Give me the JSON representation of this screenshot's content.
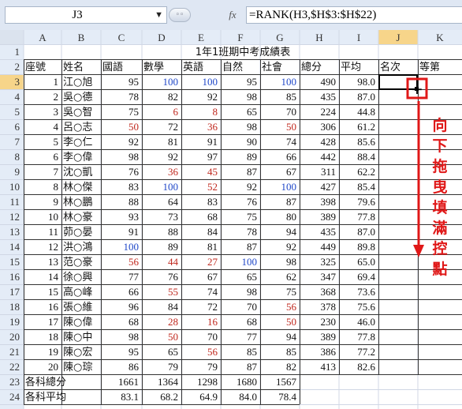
{
  "formula_bar": {
    "name_box": "J3",
    "fx_label": "fx",
    "formula": "=RANK(H3,$H$3:$H$22)"
  },
  "columns": [
    "A",
    "B",
    "C",
    "D",
    "E",
    "F",
    "G",
    "H",
    "I",
    "J",
    "K"
  ],
  "rows": [
    "1",
    "2",
    "3",
    "4",
    "5",
    "6",
    "7",
    "8",
    "9",
    "10",
    "11",
    "12",
    "13",
    "14",
    "15",
    "16",
    "17",
    "18",
    "19",
    "20",
    "21",
    "22",
    "23",
    "24"
  ],
  "title": "1年1班期中考成績表",
  "headers": [
    "座號",
    "姓名",
    "國語",
    "數學",
    "英語",
    "自然",
    "社會",
    "總分",
    "平均",
    "名次",
    "等第"
  ],
  "students": [
    [
      "1",
      "江○旭",
      "95",
      "100",
      "100",
      "95",
      "100",
      "490",
      "98.0"
    ],
    [
      "2",
      "吳○德",
      "78",
      "82",
      "92",
      "98",
      "85",
      "435",
      "87.0"
    ],
    [
      "3",
      "吳○智",
      "75",
      "6",
      "8",
      "65",
      "70",
      "224",
      "44.8"
    ],
    [
      "4",
      "呂○志",
      "50",
      "72",
      "36",
      "98",
      "50",
      "306",
      "61.2"
    ],
    [
      "5",
      "李○仁",
      "92",
      "81",
      "91",
      "90",
      "74",
      "428",
      "85.6"
    ],
    [
      "6",
      "李○偉",
      "98",
      "92",
      "97",
      "89",
      "66",
      "442",
      "88.4"
    ],
    [
      "7",
      "沈○凱",
      "76",
      "36",
      "45",
      "87",
      "67",
      "311",
      "62.2"
    ],
    [
      "8",
      "林○傑",
      "83",
      "100",
      "52",
      "92",
      "100",
      "427",
      "85.4"
    ],
    [
      "9",
      "林○鵬",
      "88",
      "64",
      "83",
      "76",
      "87",
      "398",
      "79.6"
    ],
    [
      "10",
      "林○豪",
      "93",
      "73",
      "68",
      "75",
      "80",
      "389",
      "77.8"
    ],
    [
      "11",
      "茆○晏",
      "91",
      "88",
      "84",
      "78",
      "94",
      "435",
      "87.0"
    ],
    [
      "12",
      "洪○鴻",
      "100",
      "89",
      "81",
      "87",
      "92",
      "449",
      "89.8"
    ],
    [
      "13",
      "范○豪",
      "56",
      "44",
      "27",
      "100",
      "98",
      "325",
      "65.0"
    ],
    [
      "14",
      "徐○興",
      "77",
      "76",
      "67",
      "65",
      "62",
      "347",
      "69.4"
    ],
    [
      "15",
      "高○峰",
      "66",
      "55",
      "74",
      "98",
      "75",
      "368",
      "73.6"
    ],
    [
      "16",
      "張○維",
      "96",
      "84",
      "72",
      "70",
      "56",
      "378",
      "75.6"
    ],
    [
      "17",
      "陳○偉",
      "68",
      "28",
      "16",
      "68",
      "50",
      "230",
      "46.0"
    ],
    [
      "18",
      "陳○中",
      "98",
      "50",
      "70",
      "77",
      "94",
      "389",
      "77.8"
    ],
    [
      "19",
      "陳○宏",
      "95",
      "65",
      "56",
      "85",
      "85",
      "386",
      "77.2"
    ],
    [
      "20",
      "陳○琮",
      "86",
      "79",
      "79",
      "87",
      "82",
      "413",
      "82.6"
    ]
  ],
  "totals": {
    "label": "各科總分",
    "values": [
      "1661",
      "1364",
      "1298",
      "1680",
      "1567"
    ]
  },
  "averages": {
    "label": "各科平均",
    "values": [
      "83.1",
      "68.2",
      "64.9",
      "84.0",
      "78.4"
    ]
  },
  "annotation": {
    "text": "向下拖曳填滿控點",
    "color": "#e01818"
  },
  "colors": {
    "red_score": "#c0281e",
    "blue_score": "#1f47c8",
    "black": "#111111",
    "header_bg": "#e4ecf7",
    "selected_header_bg": "#f7d58a",
    "grid_line": "#d0d7e5"
  }
}
